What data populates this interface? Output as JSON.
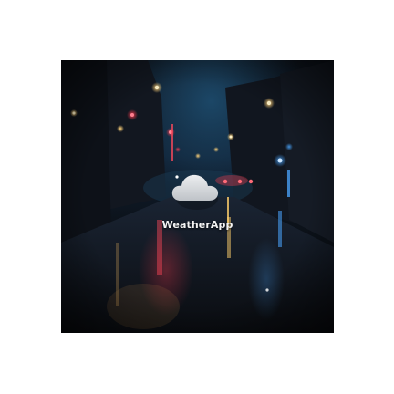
{
  "app": {
    "name": "WeatherApp",
    "icon": "cloud-icon"
  },
  "colors": {
    "page_background": "#ffffff",
    "night_sky": "#0b0f16",
    "cloud": "#d8dade",
    "app_name_text": "#f2f2f2"
  }
}
